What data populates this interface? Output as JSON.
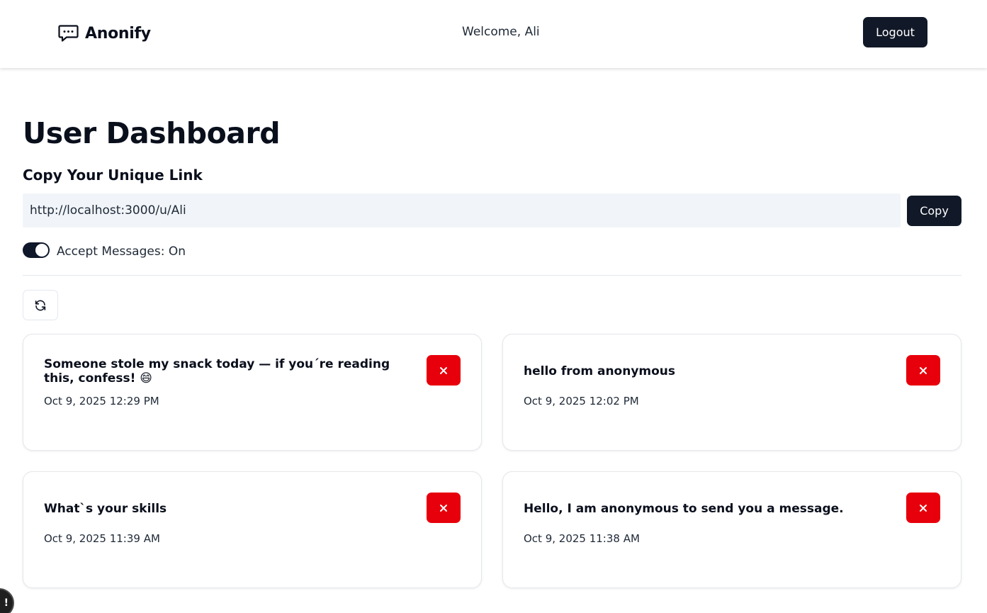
{
  "app": {
    "name": "Anonify",
    "icon": "chat-bubble-dots-icon"
  },
  "header": {
    "welcome_text": "Welcome, Ali",
    "logout_label": "Logout"
  },
  "dashboard": {
    "title": "User Dashboard",
    "link_section_title": "Copy Your Unique Link",
    "unique_link": "http://localhost:3000/u/Ali",
    "copy_label": "Copy",
    "accept_messages_label": "Accept Messages: On",
    "accept_messages_on": true,
    "refresh_icon": "refresh-icon"
  },
  "messages": [
    {
      "content": "Someone stole my snack today — if you´re reading this, confess! 😄",
      "date": "Oct 9, 2025 12:29 PM"
    },
    {
      "content": "hello from anonymous",
      "date": "Oct 9, 2025 12:02 PM"
    },
    {
      "content": "What`s your skills",
      "date": "Oct 9, 2025 11:39 AM"
    },
    {
      "content": "Hello, I am anonymous to send you a message.",
      "date": "Oct 9, 2025 11:38 AM"
    }
  ],
  "colors": {
    "primary": "#111827",
    "danger": "#e7000b",
    "input_bg": "#f1f5f9"
  },
  "corner_badge_text": "!"
}
